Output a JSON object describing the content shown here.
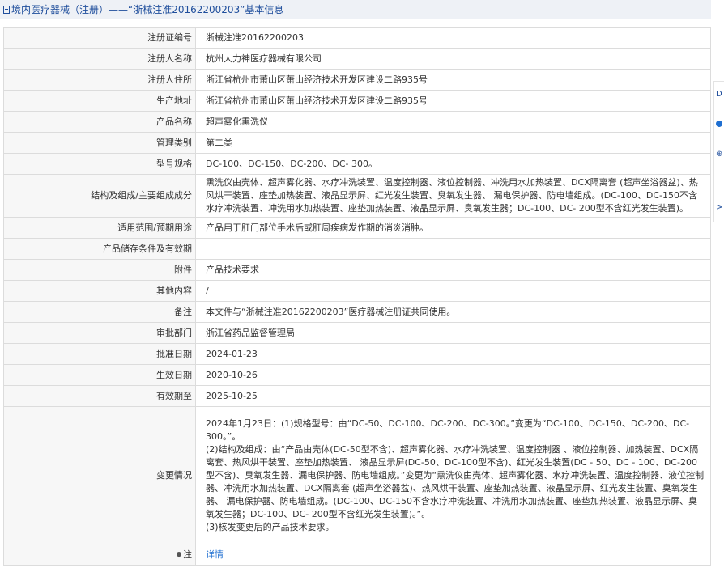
{
  "header": {
    "title": "境内医疗器械（注册）——“浙械注准20162200203”基本信息"
  },
  "rows": [
    {
      "label": "注册证编号",
      "value": "浙械注准20162200203"
    },
    {
      "label": "注册人名称",
      "value": "杭州大力神医疗器械有限公司"
    },
    {
      "label": "注册人住所",
      "value": "浙江省杭州市萧山区萧山经济技术开发区建设二路935号"
    },
    {
      "label": "生产地址",
      "value": "浙江省杭州市萧山区萧山经济技术开发区建设二路935号"
    },
    {
      "label": "产品名称",
      "value": "超声雾化熏洗仪"
    },
    {
      "label": "管理类别",
      "value": "第二类"
    },
    {
      "label": "型号规格",
      "value": "DC-100、DC-150、DC-200、DC- 300。"
    },
    {
      "label": "结构及组成/主要组成成分",
      "value": "熏洗仪由壳体、超声雾化器、水疗冲洗装置、温度控制器、液位控制器、冲洗用水加热装置、DCX隔离套 (超声坐浴器盆)、热风烘干装置、座垫加热装置、液晶显示屏、红光发生装置、臭氧发生器、 漏电保护器、防电墙组成。(DC-100、DC-150不含水疗冲洗装置、冲洗用水加热装置、座垫加热装置、液晶显示屏、臭氧发生器；DC-100、DC- 200型不含红光发生装置)。"
    },
    {
      "label": "适用范围/预期用途",
      "value": "产品用于肛门部位手术后或肛周疾病发作期的消炎消肿。"
    },
    {
      "label": "产品储存条件及有效期",
      "value": ""
    },
    {
      "label": "附件",
      "value": "产品技术要求"
    },
    {
      "label": "其他内容",
      "value": "/"
    },
    {
      "label": "备注",
      "value": "本文件与“浙械注准20162200203”医疗器械注册证共同使用。"
    },
    {
      "label": "审批部门",
      "value": "浙江省药品监督管理局"
    },
    {
      "label": "批准日期",
      "value": "2024-01-23"
    },
    {
      "label": "生效日期",
      "value": "2020-10-26"
    },
    {
      "label": "有效期至",
      "value": "2025-10-25"
    }
  ],
  "change": {
    "label": "变更情况",
    "p1": "2024年1月23日：(1)规格型号：由“DC-50、DC-100、DC-200、DC-300。”变更为“DC-100、DC-150、DC-200、DC- 300。”。",
    "p2": "(2)结构及组成：由“产品由壳体(DC-50型不含)、超声雾化器、水疗冲洗装置、温度控制器 、液位控制器、加热装置、DCX隔离套、热风烘干装置、座垫加热装置、 液晶显示屏(DC-50、DC-100型不含)、红光发生装置(DC - 50、DC - 100、DC-200型不含)、臭氧发生器、漏电保护器、防电墙组成。”变更为“熏洗仪由壳体、超声雾化器、水疗冲洗装置、温度控制器、液位控制器、冲洗用水加热装置、DCX隔离套 (超声坐浴器盆)、热风烘干装置、座垫加热装置、液晶显示屏、红光发生装置、臭氧发生器、 漏电保护器、防电墙组成。(DC-100、DC-150不含水疗冲洗装置、冲洗用水加热装置、座垫加热装置、液晶显示屏、臭氧发生器；DC-100、DC- 200型不含红光发生装置)。”。",
    "p3": "(3)核发变更后的产品技术要求。"
  },
  "note": {
    "label": "注",
    "link": "详情",
    "icon": "pin-icon"
  },
  "side_rail": {
    "icons": [
      "doc-icon",
      "info-icon",
      "copy-icon",
      "chevron-right-icon"
    ],
    "glyphs": {
      "doc": "D",
      "copy": "⊕",
      "chevron": ">"
    }
  }
}
